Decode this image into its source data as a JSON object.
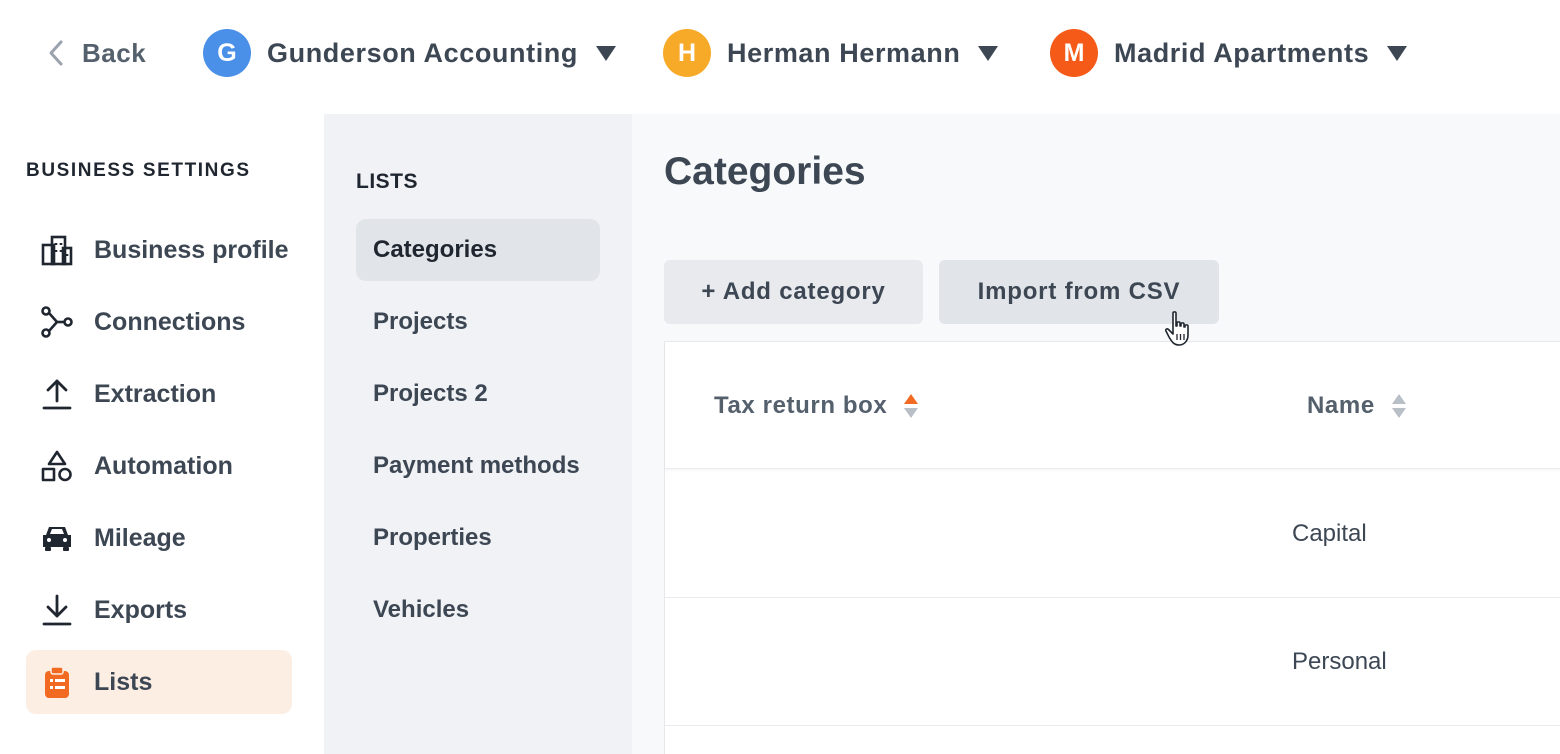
{
  "topbar": {
    "back_label": "Back",
    "accounts": [
      {
        "initial": "G",
        "name": "Gunderson Accounting",
        "color": "#4a8fe8"
      },
      {
        "initial": "H",
        "name": "Herman Hermann",
        "color": "#f7a928"
      },
      {
        "initial": "M",
        "name": "Madrid Apartments",
        "color": "#f55a18"
      }
    ]
  },
  "sidebar": {
    "heading": "BUSINESS SETTINGS",
    "items": [
      {
        "label": "Business profile",
        "icon": "building-icon"
      },
      {
        "label": "Connections",
        "icon": "connections-icon"
      },
      {
        "label": "Extraction",
        "icon": "upload-icon"
      },
      {
        "label": "Automation",
        "icon": "shapes-icon"
      },
      {
        "label": "Mileage",
        "icon": "car-icon"
      },
      {
        "label": "Exports",
        "icon": "download-icon"
      },
      {
        "label": "Lists",
        "icon": "clipboard-list-icon",
        "active": true
      }
    ],
    "accent_color": "#f26a22"
  },
  "lists_panel": {
    "heading": "LISTS",
    "items": [
      {
        "label": "Categories",
        "active": true
      },
      {
        "label": "Projects"
      },
      {
        "label": "Projects 2"
      },
      {
        "label": "Payment methods"
      },
      {
        "label": "Properties"
      },
      {
        "label": "Vehicles"
      }
    ]
  },
  "main": {
    "title": "Categories",
    "add_button": "+ Add category",
    "import_button": "Import from CSV",
    "table": {
      "columns": [
        {
          "label": "Tax return box",
          "sort": "ascending"
        },
        {
          "label": "Name",
          "sort": "none"
        }
      ],
      "rows": [
        {
          "tax_return_box": "",
          "name": "Capital"
        },
        {
          "tax_return_box": "",
          "name": "Personal"
        }
      ]
    }
  }
}
